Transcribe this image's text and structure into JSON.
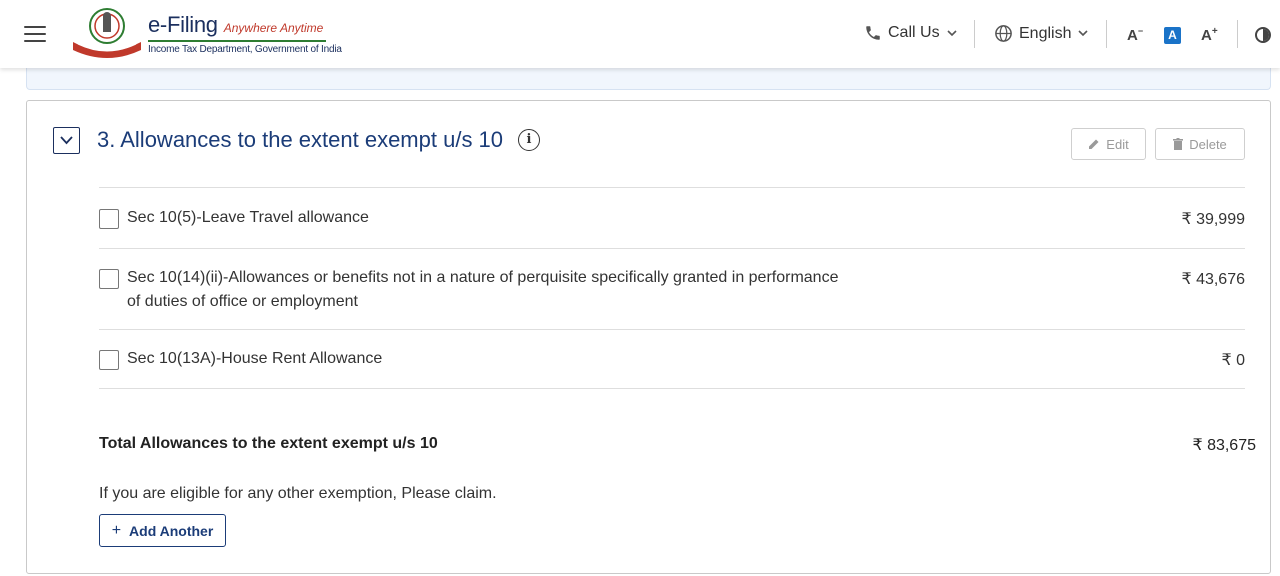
{
  "header": {
    "brand_name": "e-Filing",
    "brand_tagline": "Anywhere Anytime",
    "brand_subtitle": "Income Tax Department, Government of India",
    "call_us": "Call Us",
    "language": "English",
    "font_decrease": "A",
    "font_normal": "A",
    "font_increase": "A"
  },
  "section": {
    "title": "3. Allowances to the extent exempt u/s 10",
    "edit_label": "Edit",
    "delete_label": "Delete",
    "items": [
      {
        "label": "Sec 10(5)-Leave Travel allowance",
        "amount": "₹ 39,999",
        "checked": false
      },
      {
        "label": "Sec 10(14)(ii)-Allowances or benefits not in a nature of perquisite specifically granted in performance of duties of office or employment",
        "amount": "₹ 43,676",
        "checked": false
      },
      {
        "label": "Sec 10(13A)-House Rent Allowance",
        "amount": "₹ 0",
        "checked": false
      }
    ],
    "total_label": "Total Allowances to the extent exempt u/s 10",
    "total_amount": "₹ 83,675",
    "claim_text": "If you are eligible for any other exemption, Please claim.",
    "add_another_label": "Add Another"
  },
  "colors": {
    "primary": "#1b3c78",
    "accent_blue": "#1a73c8",
    "border": "#c9c9c9"
  }
}
